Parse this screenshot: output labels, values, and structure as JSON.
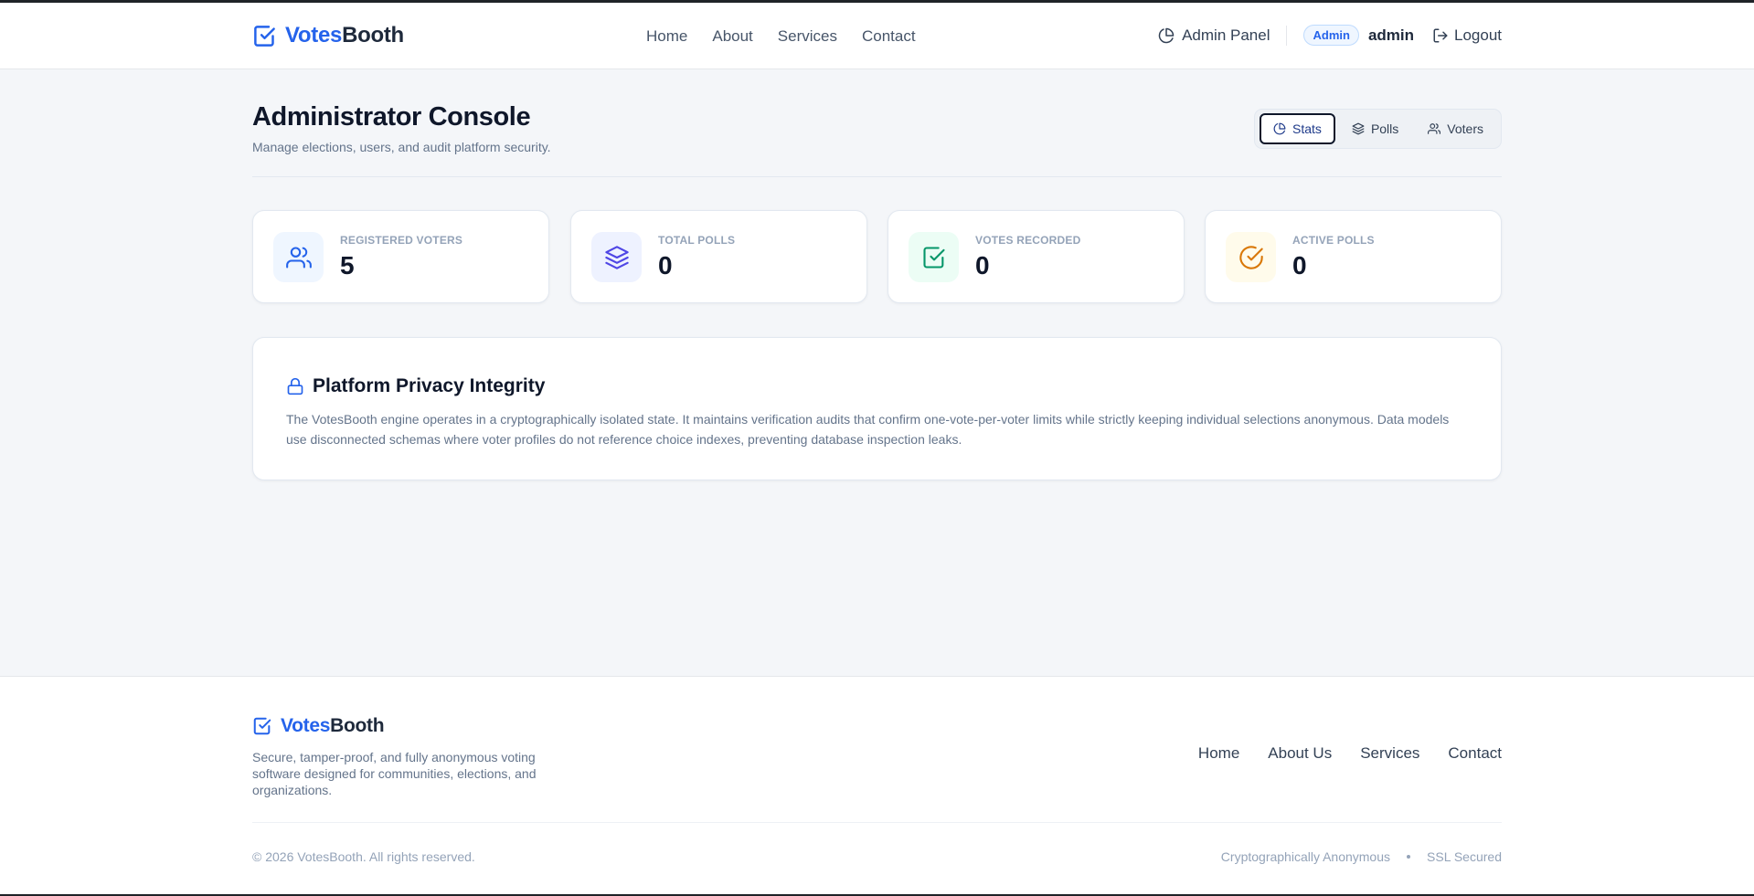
{
  "header": {
    "brand_accent": "Votes",
    "brand_rest": "Booth",
    "nav": [
      "Home",
      "About",
      "Services",
      "Contact"
    ],
    "admin_panel": "Admin Panel",
    "role_badge": "Admin",
    "username": "admin",
    "logout": "Logout"
  },
  "page": {
    "title": "Administrator Console",
    "subtitle": "Manage elections, users, and audit platform security.",
    "tabs": [
      {
        "label": "Stats",
        "icon": "pie-chart-icon",
        "active": true
      },
      {
        "label": "Polls",
        "icon": "layers-icon",
        "active": false
      },
      {
        "label": "Voters",
        "icon": "users-icon",
        "active": false
      }
    ]
  },
  "stats": [
    {
      "label": "REGISTERED VOTERS",
      "value": "5",
      "icon": "users-icon",
      "color": "#2563eb",
      "bg": "#eff6ff"
    },
    {
      "label": "TOTAL POLLS",
      "value": "0",
      "icon": "layers-icon",
      "color": "#4f46e5",
      "bg": "#eef2ff"
    },
    {
      "label": "VOTES RECORDED",
      "value": "0",
      "icon": "check-square-icon",
      "color": "#059669",
      "bg": "#ecfdf5"
    },
    {
      "label": "ACTIVE POLLS",
      "value": "0",
      "icon": "check-circle-icon",
      "color": "#d97706",
      "bg": "#fffbeb"
    }
  ],
  "privacy": {
    "title": "Platform Privacy Integrity",
    "body": "The VotesBooth engine operates in a cryptographically isolated state. It maintains verification audits that confirm one-vote-per-voter limits while strictly keeping individual selections anonymous. Data models use disconnected schemas where voter profiles do not reference choice indexes, preventing database inspection leaks."
  },
  "footer": {
    "brand_accent": "Votes",
    "brand_rest": "Booth",
    "tagline": "Secure, tamper-proof, and fully anonymous voting software designed for communities, elections, and organizations.",
    "nav": [
      "Home",
      "About Us",
      "Services",
      "Contact"
    ],
    "copyright": "© 2026 VotesBooth. All rights reserved.",
    "badge_1": "Cryptographically Anonymous",
    "badge_2": "SSL Secured"
  },
  "colors": {
    "accent": "#2563eb",
    "text_dark": "#0f172a",
    "muted": "#64748b",
    "background": "#f4f6f9"
  }
}
